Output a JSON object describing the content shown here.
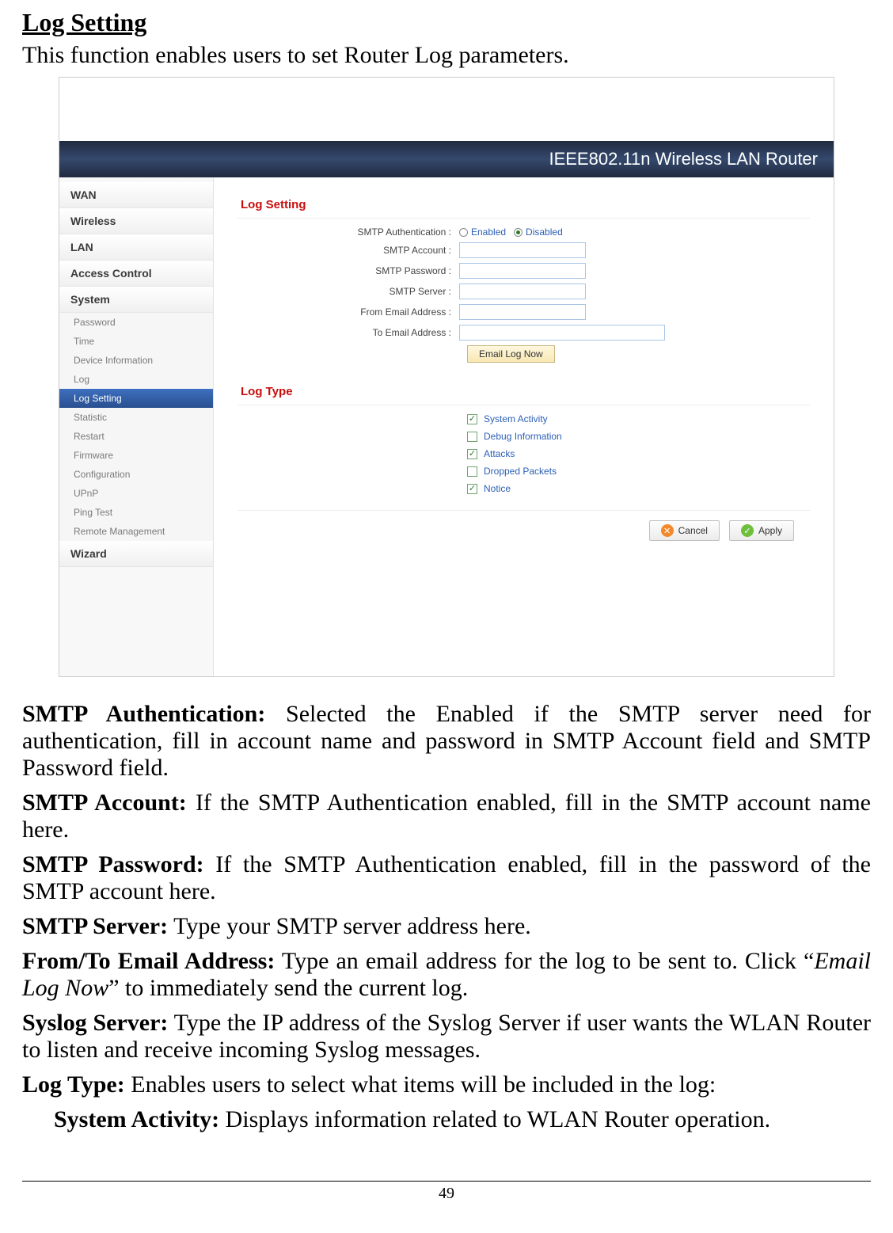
{
  "page": {
    "section_title": "Log Setting",
    "intro": "This function enables users to set Router Log parameters.",
    "page_number": "49"
  },
  "screenshot": {
    "banner": "IEEE802.11n  Wireless LAN Router",
    "sidebar": {
      "wan": "WAN",
      "wireless": "Wireless",
      "lan": "LAN",
      "access_control": "Access Control",
      "system": "System",
      "subs": {
        "password": "Password",
        "time": "Time",
        "device_info": "Device Information",
        "log": "Log",
        "log_setting": "Log Setting",
        "statistic": "Statistic",
        "restart": "Restart",
        "firmware": "Firmware",
        "configuration": "Configuration",
        "upnp": "UPnP",
        "ping_test": "Ping Test",
        "remote_mgmt": "Remote Management"
      },
      "wizard": "Wizard"
    },
    "panel1_title": "Log Setting",
    "labels": {
      "smtp_auth": "SMTP Authentication :",
      "smtp_account": "SMTP Account :",
      "smtp_password": "SMTP Password :",
      "smtp_server": "SMTP Server :",
      "from_email": "From Email Address :",
      "to_email": "To Email Address :"
    },
    "radio": {
      "enabled": "Enabled",
      "disabled": "Disabled"
    },
    "email_log_now": "Email Log Now",
    "panel2_title": "Log Type",
    "checks": {
      "system_activity": "System Activity",
      "debug_info": "Debug Information",
      "attacks": "Attacks",
      "dropped_packets": "Dropped Packets",
      "notice": "Notice"
    },
    "actions": {
      "cancel": "Cancel",
      "apply": "Apply"
    }
  },
  "definitions": {
    "smtp_auth_label": "SMTP  Authentication:",
    "smtp_auth_text": "  Selected the Enabled if the SMTP server need for authentication, fill in account name and password in SMTP Account field and SMTP Password field.",
    "smtp_account_label": "SMTP  Account:",
    "smtp_account_text": "  If the SMTP Authentication enabled, fill in the SMTP account name here.",
    "smtp_password_label": "SMTP Password:",
    "smtp_password_text": " If the SMTP Authentication enabled, fill in the password of the SMTP account here.",
    "smtp_server_label": "SMTP Server:",
    "smtp_server_text": " Type your SMTP server address here.",
    "from_to_label": "From/To Email Address:",
    "from_to_text_a": " Type an email address for the log to be sent to. Click “",
    "from_to_italic": "Email Log Now",
    "from_to_text_b": "” to immediately send the current log.",
    "syslog_label": "Syslog Server:",
    "syslog_text": " Type the IP address of the Syslog Server if user wants the WLAN Router to listen and receive incoming Syslog messages.",
    "logtype_label": "Log Type:",
    "logtype_text": " Enables users to select what items will be included in the log:",
    "system_activity_label": "System Activity:",
    "system_activity_text": " Displays information related to WLAN Router operation."
  }
}
